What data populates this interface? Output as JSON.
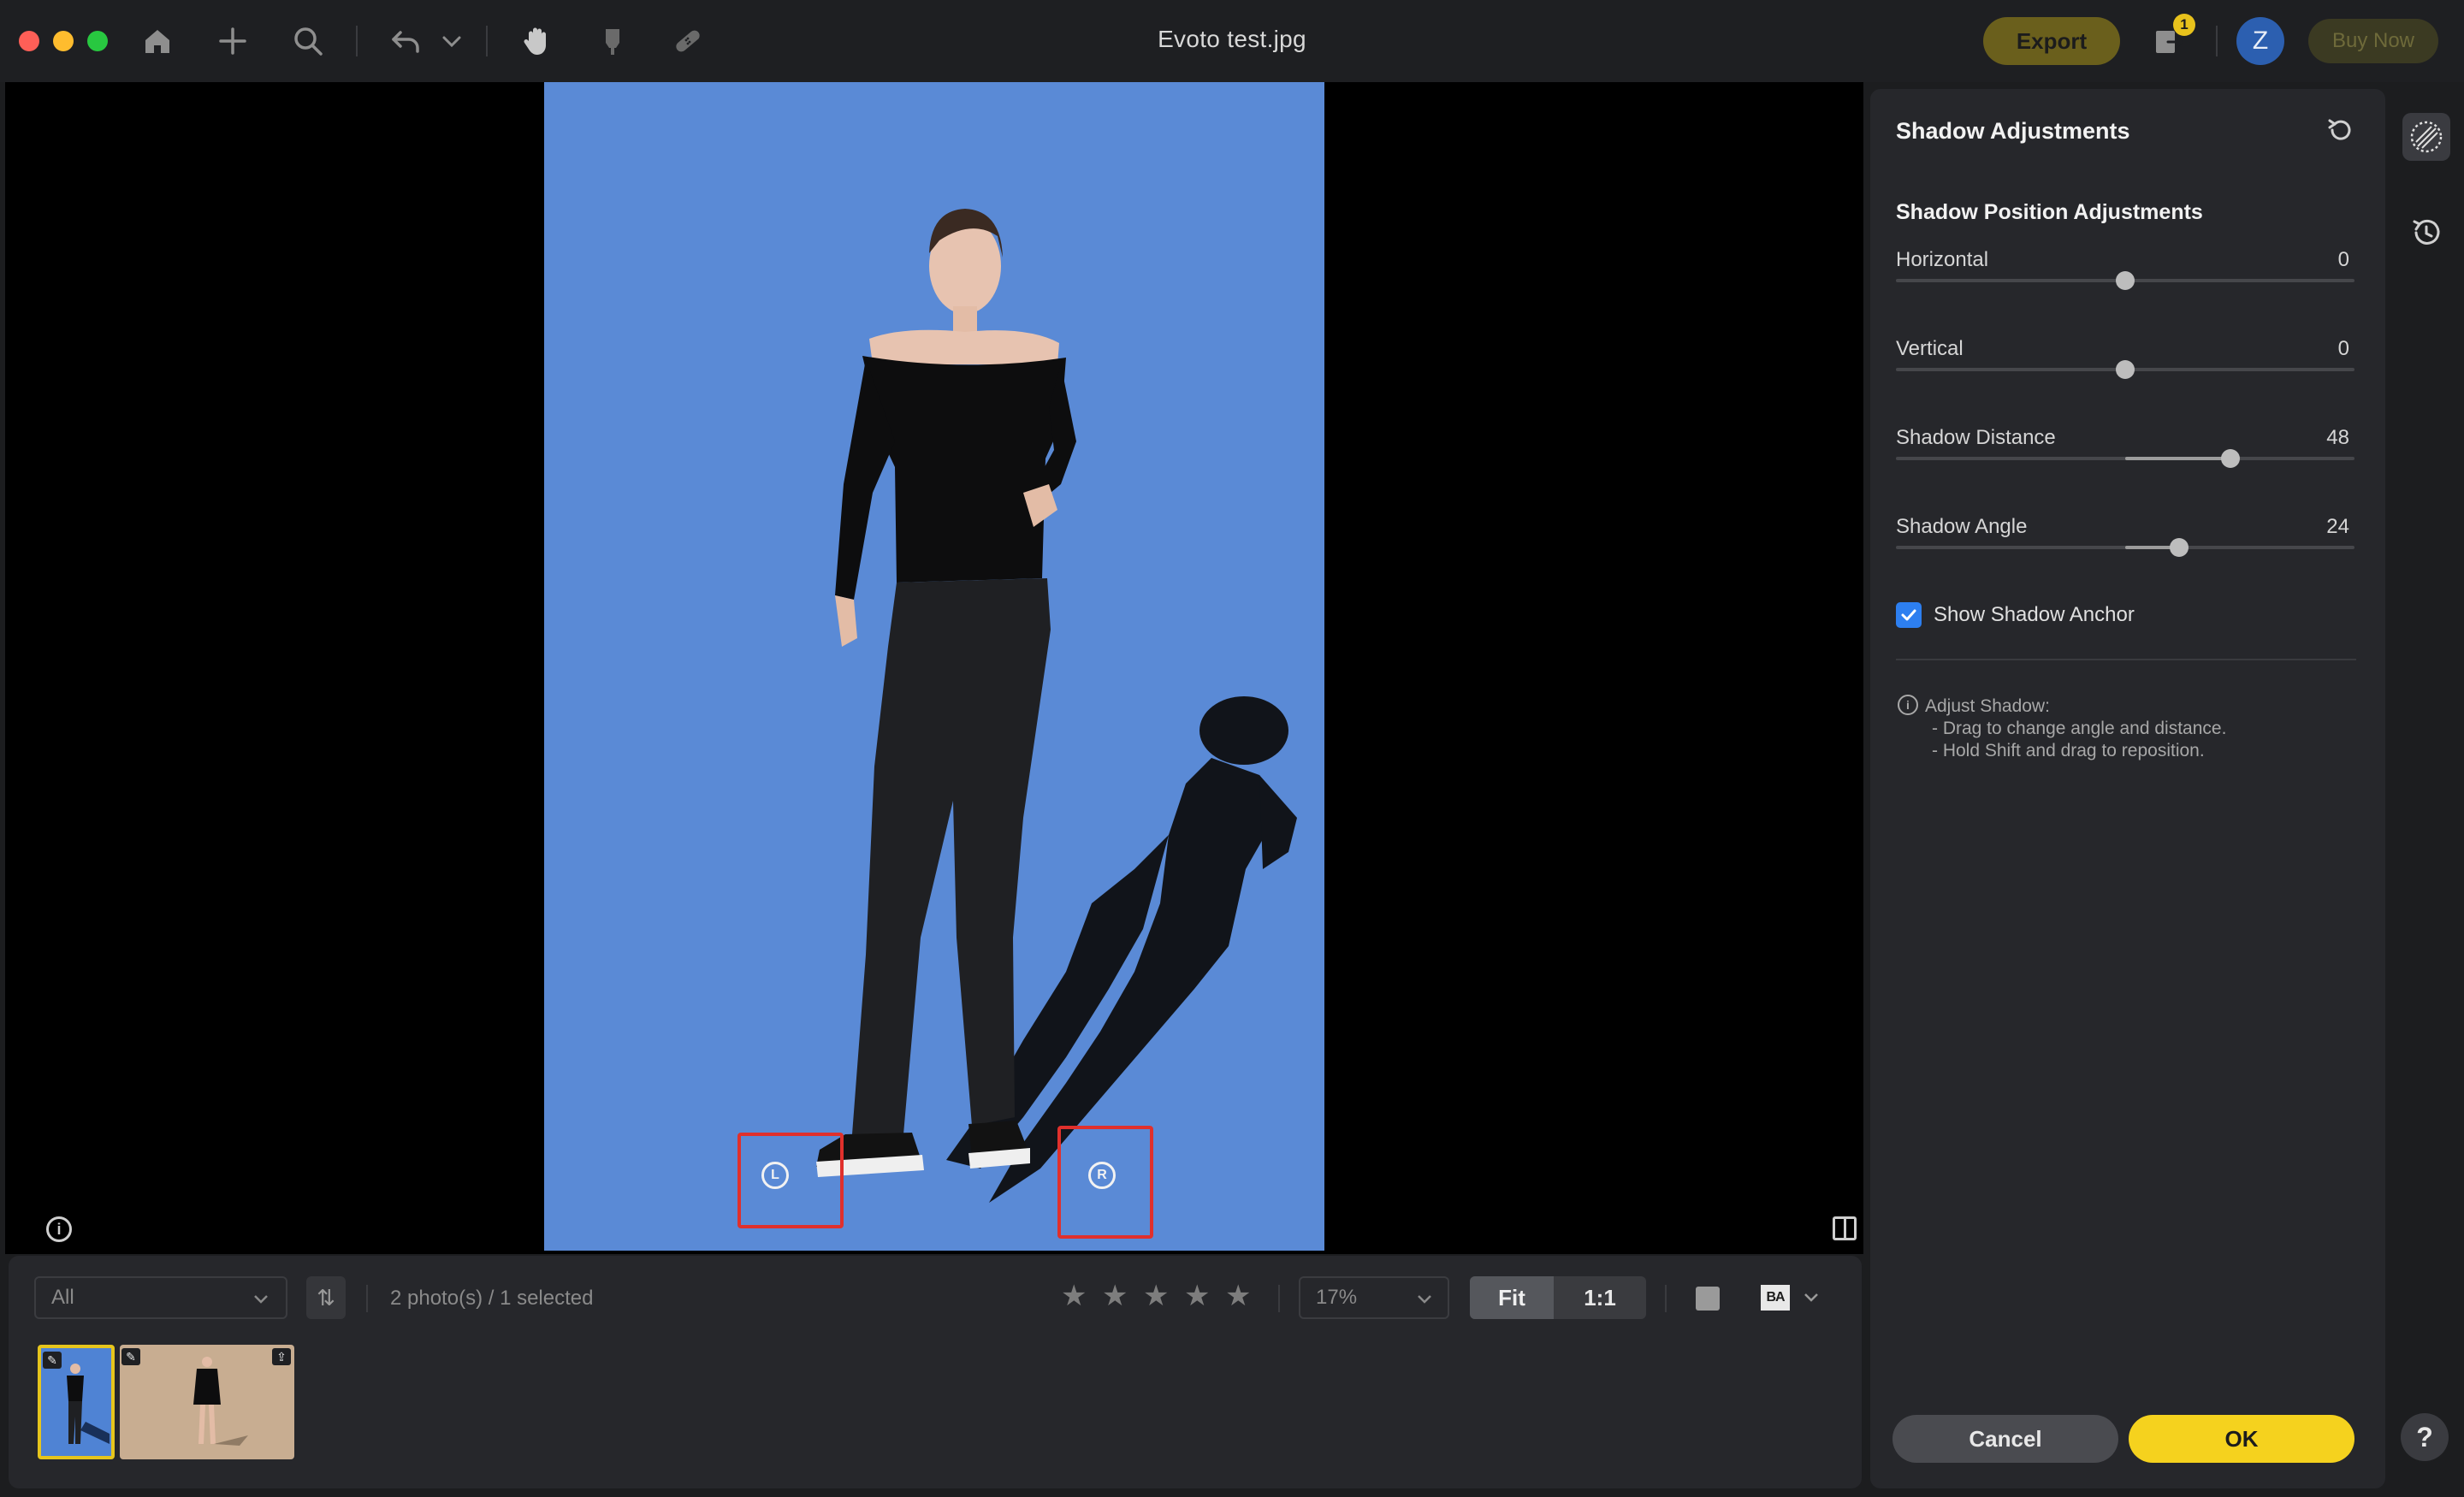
{
  "window": {
    "title": "Evoto test.jpg"
  },
  "colors": {
    "accent": "#f5d21e",
    "canvas_bg": "#5a8ad6",
    "anchor_box": "#e0302c",
    "checkbox": "#2d7ff0"
  },
  "toolbar": {
    "icons": [
      "home-icon",
      "add-icon",
      "search-icon",
      "undo-icon",
      "undo-menu-chevron-icon",
      "hand-tool-icon",
      "brush-tool-icon",
      "bandage-tool-icon"
    ],
    "export_label": "Export",
    "notification_count": "1",
    "avatar_initial": "Z",
    "buy_now_label": "Buy Now"
  },
  "canvas": {
    "anchor_left_label": "L",
    "anchor_right_label": "R"
  },
  "filmstrip": {
    "filter_value": "All",
    "sort_label": "⇅",
    "photo_count": "2 photo(s) / 1 selected",
    "rating_stars": 5,
    "zoom_value": "17%",
    "fit_label": "Fit",
    "one_to_one_label": "1:1",
    "before_after_label": "BA"
  },
  "panel": {
    "title": "Shadow Adjustments",
    "section_title": "Shadow Position Adjustments",
    "sliders": [
      {
        "label": "Horizontal",
        "value": "0"
      },
      {
        "label": "Vertical",
        "value": "0"
      },
      {
        "label": "Shadow Distance",
        "value": "48"
      },
      {
        "label": "Shadow Angle",
        "value": "24"
      }
    ],
    "show_anchor_label": "Show Shadow Anchor",
    "show_anchor_checked": true,
    "hint": [
      "Adjust Shadow:",
      "- Drag to change angle and distance.",
      "- Hold Shift and drag to reposition."
    ],
    "cancel_label": "Cancel",
    "ok_label": "OK"
  },
  "rail": {
    "help_label": "?"
  }
}
